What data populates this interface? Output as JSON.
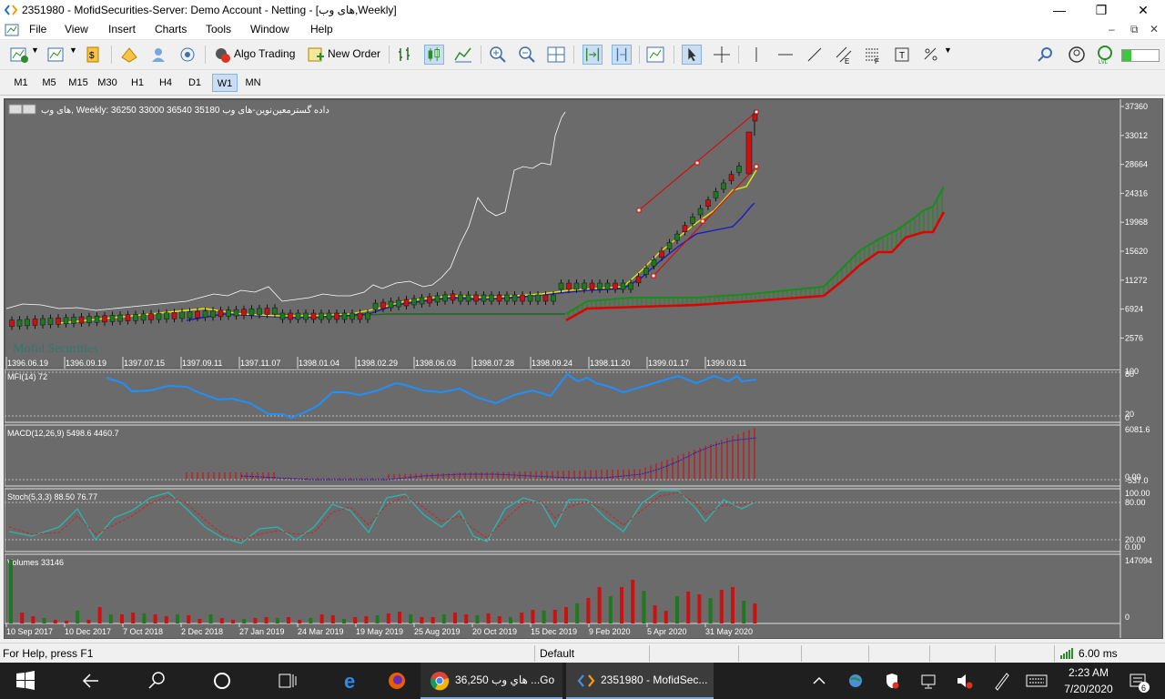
{
  "window": {
    "title": "2351980 - MofidSecurities-Server: Demo Account - Netting - [های وب,Weekly]"
  },
  "menu": [
    "File",
    "View",
    "Insert",
    "Charts",
    "Tools",
    "Window",
    "Help"
  ],
  "toolbar": {
    "algo_trading": "Algo Trading",
    "new_order": "New Order"
  },
  "timeframes": [
    "M1",
    "M5",
    "M15",
    "M30",
    "H1",
    "H4",
    "D1",
    "W1",
    "MN"
  ],
  "timeframe_active": "W1",
  "chart": {
    "header": "های وب, Weekly:  36250 33000 36540 35180  داده گسترمعین‌نوین-های وب",
    "watermark": "Mofid Securities",
    "price_ticks": [
      "37360",
      "33012",
      "28664",
      "24316",
      "19968",
      "15620",
      "11272",
      "6924",
      "2576"
    ],
    "date_ticks": [
      "1396.06.19",
      "1396.09.19",
      "1397.07.15",
      "1397.09.11",
      "1397.11.07",
      "1398.01.04",
      "1398.02.29",
      "1398.06.03",
      "1398.07.28",
      "1398.09.24",
      "1398.11.20",
      "1399.01.17",
      "1399.03.11"
    ],
    "mfi_label": "MFI(14) 72",
    "mfi_ticks": [
      "100",
      "80",
      "20",
      "0"
    ],
    "macd_label": "MACD(12,26,9) 5498.6 4460.7",
    "macd_ticks": [
      "6081.6",
      "0.00",
      "-537.0"
    ],
    "stoch_label": "Stoch(5,3,3) 88.50 76.77",
    "stoch_ticks": [
      "100.00",
      "80.00",
      "20.00",
      "0.00"
    ],
    "volume_label": "Volumes 33146",
    "volume_ticks": [
      "147094",
      "0"
    ],
    "bottom_dates": [
      "10 Sep 2017",
      "10 Dec 2017",
      "7 Oct 2018",
      "2 Dec 2018",
      "27 Jan 2019",
      "24 Mar 2019",
      "19 May 2019",
      "25 Aug 2019",
      "20 Oct 2019",
      "15 Dec 2019",
      "9 Feb 2020",
      "5 Apr 2020",
      "31 May 2020"
    ]
  },
  "status": {
    "help": "For Help, press F1",
    "profile": "Default",
    "ping": "6.00 ms"
  },
  "taskbar": {
    "chrome_tab": "هاي وب 36,250 ...Go",
    "mt_tab": "2351980 - MofidSec...",
    "time": "2:23 AM",
    "date": "7/20/2020",
    "notifications": "6"
  },
  "colors": {
    "chart_bg": "#6b6b6b",
    "bull_candle": "#1f7a1f",
    "bear_candle": "#cc1111",
    "mfi_line": "#1e90ff",
    "ichimoku_green": "#1a8c1a",
    "ichimoku_red": "#e00000"
  }
}
